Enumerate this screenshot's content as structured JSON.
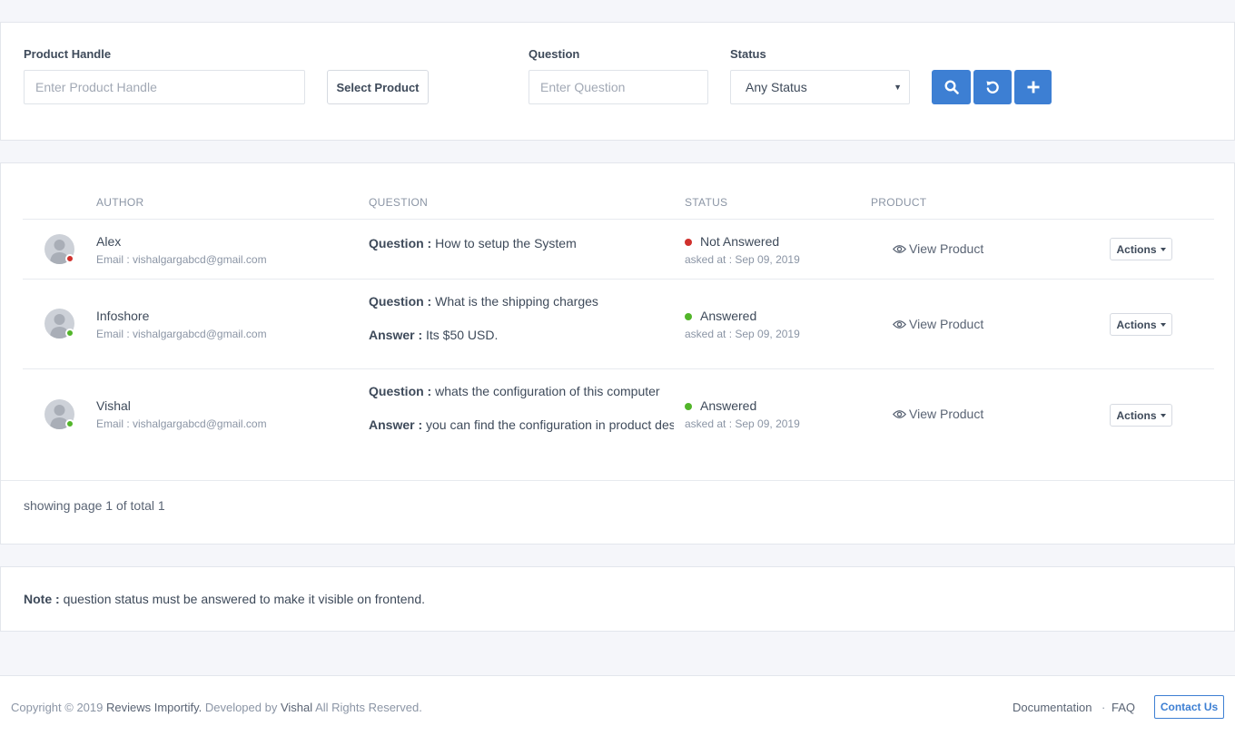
{
  "filters": {
    "product_handle_label": "Product Handle",
    "product_handle_placeholder": "Enter Product Handle",
    "select_product_label": "Select Product",
    "question_label": "Question",
    "question_placeholder": "Enter Question",
    "status_label": "Status",
    "status_selected": "Any Status"
  },
  "table": {
    "headers": [
      "AUTHOR",
      "QUESTION",
      "STATUS",
      "PRODUCT"
    ],
    "question_prefix": "Question :",
    "answer_prefix": "Answer :",
    "view_product_label": "View Product",
    "actions_label": "Actions",
    "rows": [
      {
        "author": "Alex",
        "email": "Email : vishalgargabcd@gmail.com",
        "question": "How to setup the System",
        "answer": "",
        "status": "Not Answered",
        "status_color": "#d0312d",
        "asked_at": "asked at : Sep 09, 2019"
      },
      {
        "author": "Infoshore",
        "email": "Email : vishalgargabcd@gmail.com",
        "question": "What is the shipping charges",
        "answer": "Its $50 USD.",
        "status": "Answered",
        "status_color": "#52b52a",
        "asked_at": "asked at : Sep 09, 2019"
      },
      {
        "author": "Vishal",
        "email": "Email : vishalgargabcd@gmail.com",
        "question": "whats the configuration of this computer",
        "answer": "you can find the configuration in product description",
        "status": "Answered",
        "status_color": "#52b52a",
        "asked_at": "asked at : Sep 09, 2019"
      }
    ],
    "pagination": "showing page 1 of total 1"
  },
  "note": {
    "label": "Note :",
    "text": "question status must be answered to make it visible on frontend."
  },
  "footer": {
    "copyright_prefix": "Copyright © 2019",
    "app_name": "Reviews Importify.",
    "developed_by": "Developed by",
    "developer": "Vishal",
    "rights": "All Rights Reserved.",
    "documentation": "Documentation",
    "separator": "·",
    "faq": "FAQ",
    "contact": "Contact Us"
  },
  "colors": {
    "accent": "#3d7fd3",
    "not_answered": "#d0312d",
    "answered": "#52b52a"
  },
  "icons": {
    "search": "search-icon",
    "reset": "reset-icon",
    "add": "plus-icon",
    "view": "eye-icon",
    "dropdown": "caret-down-icon"
  }
}
